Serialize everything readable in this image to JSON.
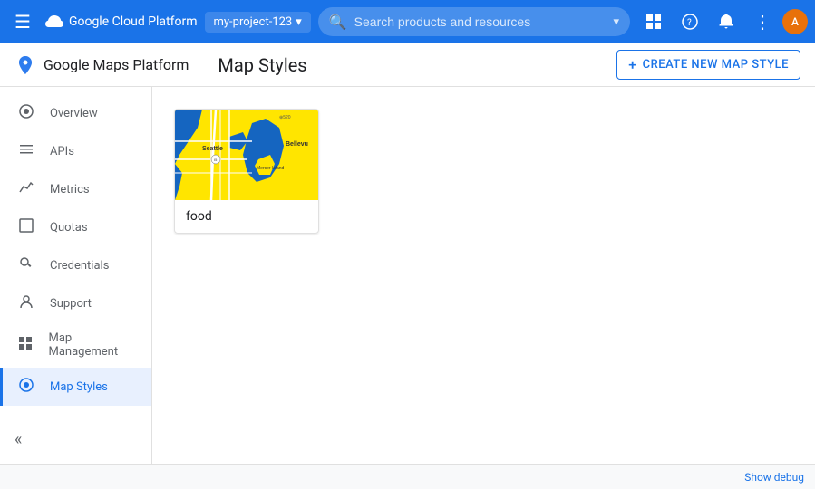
{
  "topBar": {
    "menuIcon": "☰",
    "appName": "Google Cloud Platform",
    "projectName": "my-project-123",
    "searchPlaceholder": "Search products and resources",
    "searchDropdownIcon": "▾",
    "icons": {
      "grid": "⊞",
      "help": "?",
      "bell": "🔔",
      "more": "⋮"
    },
    "avatarInitial": "A"
  },
  "subHeader": {
    "appName": "Google Maps Platform",
    "pageTitle": "Map Styles",
    "createButton": "CREATE NEW MAP STYLE",
    "createIcon": "+"
  },
  "sidebar": {
    "items": [
      {
        "id": "overview",
        "label": "Overview",
        "icon": "⊙",
        "active": false
      },
      {
        "id": "apis",
        "label": "APIs",
        "icon": "≡",
        "active": false
      },
      {
        "id": "metrics",
        "label": "Metrics",
        "icon": "↗",
        "active": false
      },
      {
        "id": "quotas",
        "label": "Quotas",
        "icon": "▭",
        "active": false
      },
      {
        "id": "credentials",
        "label": "Credentials",
        "icon": "🔑",
        "active": false
      },
      {
        "id": "support",
        "label": "Support",
        "icon": "👤",
        "active": false
      },
      {
        "id": "map-management",
        "label": "Map Management",
        "icon": "▦",
        "active": false
      },
      {
        "id": "map-styles",
        "label": "Map Styles",
        "icon": "◎",
        "active": true
      }
    ],
    "collapseIcon": "«"
  },
  "mapCard": {
    "label": "food",
    "thumbnail": {
      "bgColor": "#FFE500",
      "waterColor": "#1565C0",
      "cityLabel": "Seattle",
      "cityLabel2": "Bellevue"
    }
  },
  "bottomBar": {
    "showDebugLabel": "Show debug"
  }
}
